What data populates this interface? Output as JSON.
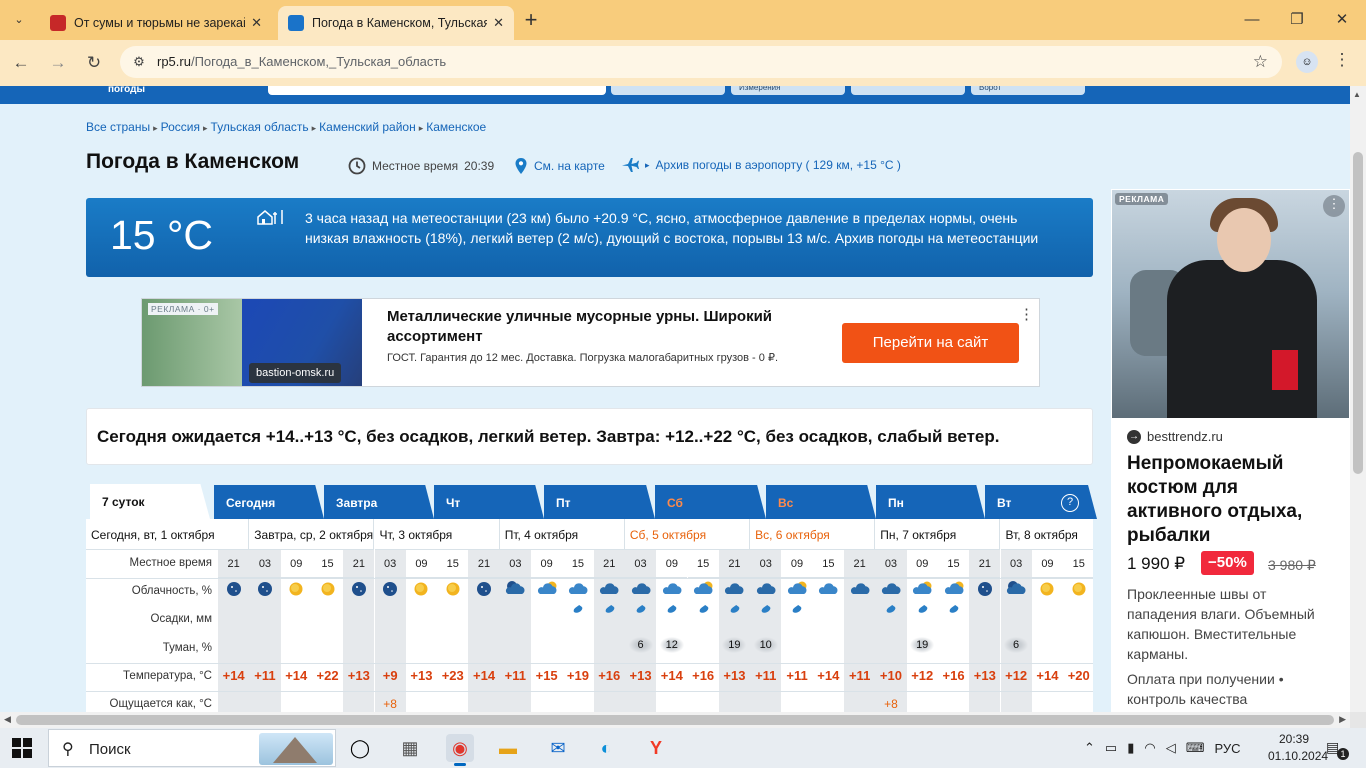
{
  "browser": {
    "tabs": [
      {
        "title": "От сумы и тюрьмы не зарекайся",
        "active": false
      },
      {
        "title": "Погода в Каменском, Тульская область",
        "active": true
      }
    ],
    "url_host": "rp5.ru",
    "url_path": "/Погода_в_Каменском,_Тульская_область",
    "new_tab": "+",
    "minimize": "—",
    "restore": "❐",
    "close": "✕"
  },
  "site": {
    "logo_fragment": "погоды",
    "strip_fields": [
      "Измерения",
      "Ворот"
    ]
  },
  "breadcrumbs": [
    "Все страны",
    "Россия",
    "Тульская область",
    "Каменский район",
    "Каменское"
  ],
  "header": {
    "title": "Погода в Каменском",
    "local_time_label": "Местное время",
    "local_time": "20:39",
    "map_link": "См. на карте",
    "archive_link": "Архив погоды в аэропорту ( 129 км, +15 °C )"
  },
  "current": {
    "temperature": "15 °C",
    "text": "3 часа назад на метеостанции (23 км) было +20.9 °C, ясно, атмосферное давление в пределах нормы, очень низкая влажность (18%), легкий ветер (2 м/с), дующий с востока, порывы 13 м/с. Архив погоды на метеостанции"
  },
  "ad_top": {
    "label": "РЕКЛАМА · 0+",
    "domain": "bastion-omsk.ru",
    "headline": "Металлические уличные мусорные урны. Широкий ассортимент",
    "sub": "ГОСТ. Гарантия до 12 мес. Доставка. Погрузка малогабаритных грузов - 0 ₽.",
    "button": "Перейти на сайт"
  },
  "forecast_summary": "Сегодня ожидается +14..+13 °C, без осадков, легкий ветер. Завтра: +12..+22 °C, без осадков, слабый ветер.",
  "forecast": {
    "tabs": [
      {
        "label": "7 суток",
        "selected": true,
        "weekend": false
      },
      {
        "label": "Сегодня",
        "selected": false,
        "weekend": false
      },
      {
        "label": "Завтра",
        "selected": false,
        "weekend": false
      },
      {
        "label": "Чт",
        "selected": false,
        "weekend": false
      },
      {
        "label": "Пт",
        "selected": false,
        "weekend": false
      },
      {
        "label": "Сб",
        "selected": false,
        "weekend": true
      },
      {
        "label": "Вс",
        "selected": false,
        "weekend": true
      },
      {
        "label": "Пн",
        "selected": false,
        "weekend": false
      },
      {
        "label": "Вт",
        "selected": false,
        "weekend": false
      }
    ],
    "help": "?",
    "days": [
      {
        "label": "Сегодня, вт, 1 октября",
        "weekend": false
      },
      {
        "label": "Завтра, ср, 2 октября",
        "weekend": false
      },
      {
        "label": "Чт, 3 октября",
        "weekend": false
      },
      {
        "label": "Пт, 4 октября",
        "weekend": false
      },
      {
        "label": "Сб, 5 октября",
        "weekend": true
      },
      {
        "label": "Вс, 6 октября",
        "weekend": true
      },
      {
        "label": "Пн, 7 октября",
        "weekend": false
      },
      {
        "label": "Вт, 8 октября",
        "weekend": false
      }
    ],
    "row_labels": [
      "Местное время",
      "Облачность, %",
      "Осадки, мм",
      "Туман, %",
      "Температура, °C",
      "Ощущается как, °C"
    ],
    "hours": [
      "21",
      "03",
      "09",
      "15",
      "21",
      "03",
      "09",
      "15",
      "21",
      "03",
      "09",
      "15",
      "21",
      "03",
      "09",
      "15",
      "21",
      "03",
      "09",
      "15",
      "21",
      "03",
      "09",
      "15",
      "21",
      "03",
      "09",
      "15"
    ],
    "night": [
      true,
      true,
      false,
      false,
      true,
      true,
      false,
      false,
      true,
      true,
      false,
      false,
      true,
      true,
      false,
      false,
      true,
      true,
      false,
      false,
      true,
      true,
      false,
      false,
      true,
      true,
      false,
      false
    ],
    "cloud_icons": [
      "moon",
      "moon",
      "sun",
      "sun",
      "moon",
      "moon",
      "sun",
      "sun",
      "moon",
      "moon-cloud",
      "sun-cloud",
      "cloud",
      "cloud-night",
      "cloud-night",
      "cloud",
      "sun-cloud",
      "cloud-night",
      "cloud-night",
      "sun-cloud",
      "cloud",
      "cloud-night",
      "cloud-night",
      "sun-cloud",
      "sun-cloud",
      "moon",
      "moon-cloud",
      "sun",
      "sun"
    ],
    "precip": [
      false,
      false,
      false,
      false,
      false,
      false,
      false,
      false,
      false,
      false,
      false,
      true,
      true,
      true,
      true,
      true,
      true,
      true,
      true,
      false,
      false,
      true,
      true,
      true,
      false,
      false,
      false,
      false
    ],
    "fog": [
      "",
      "",
      "",
      "",
      "",
      "",
      "",
      "",
      "",
      "",
      "",
      "",
      "",
      "6",
      "12",
      "",
      "19",
      "10",
      "",
      "",
      "",
      "",
      "19",
      "",
      "",
      "6",
      "",
      ""
    ],
    "temperatures": [
      "+14",
      "+11",
      "+14",
      "+22",
      "+13",
      "+9",
      "+13",
      "+23",
      "+14",
      "+11",
      "+15",
      "+19",
      "+16",
      "+13",
      "+14",
      "+16",
      "+13",
      "+11",
      "+11",
      "+14",
      "+11",
      "+10",
      "+12",
      "+16",
      "+13",
      "+12",
      "+14",
      "+20"
    ],
    "feels_like": [
      "",
      "",
      "",
      "",
      "",
      "+8",
      "",
      "",
      "",
      "",
      "",
      "",
      "",
      "",
      "",
      "",
      "",
      "",
      "",
      "",
      "",
      "+8",
      "",
      "",
      "",
      "",
      "",
      ""
    ]
  },
  "ad_right": {
    "label": "РЕКЛАМА",
    "domain": "besttrendz.ru",
    "headline": "Непромокаемый костюм для активного отдыха, рыбалки",
    "price": "1 990 ₽",
    "discount": "−50%",
    "old_price": "3 980 ₽",
    "desc1": "Проклеенные швы от пападения влаги. Объемный капюшон. Вместительные карманы.",
    "desc2": "Оплата при получении • контроль качества"
  },
  "taskbar": {
    "search_placeholder": "Поиск",
    "lang": "РУС",
    "time": "20:39",
    "date": "01.10.2024",
    "notif_count": "1"
  },
  "colors": {
    "accent": "#1565b8",
    "temp_red": "#d9400f",
    "ad_button": "#f15215",
    "page_bg": "#e2f1fa"
  }
}
